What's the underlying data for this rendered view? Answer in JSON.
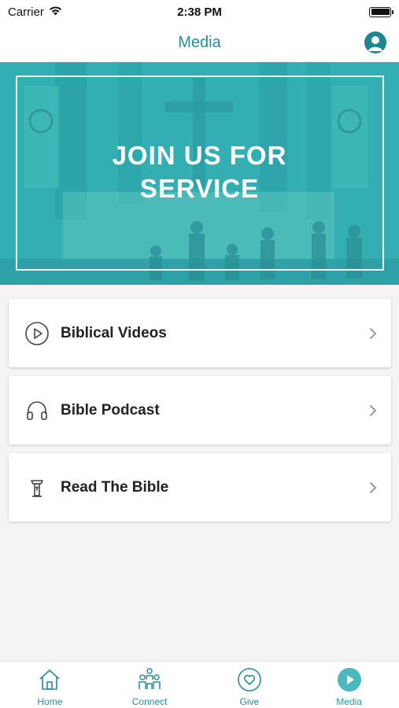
{
  "status_bar": {
    "carrier": "Carrier",
    "time": "2:38 PM",
    "wifi_icon": "wifi-icon",
    "battery_icon": "battery-icon"
  },
  "nav": {
    "title": "Media",
    "profile_icon": "person-icon"
  },
  "hero": {
    "title": "JOIN US FOR\nSERVICE"
  },
  "menu": [
    {
      "label": "Biblical Videos",
      "icon": "play-circle-icon"
    },
    {
      "label": "Bible Podcast",
      "icon": "headphones-icon"
    },
    {
      "label": "Read The Bible",
      "icon": "lectern-icon"
    }
  ],
  "tabs": [
    {
      "label": "Home",
      "icon": "home-icon",
      "active": false
    },
    {
      "label": "Connect",
      "icon": "people-icon",
      "active": false
    },
    {
      "label": "Give",
      "icon": "heart-circle-icon",
      "active": false
    },
    {
      "label": "Media",
      "icon": "play-filled-icon",
      "active": true
    }
  ],
  "colors": {
    "accent": "#2b8b98",
    "hero_teal": "#3db5b5",
    "background": "#f4f4f4"
  }
}
